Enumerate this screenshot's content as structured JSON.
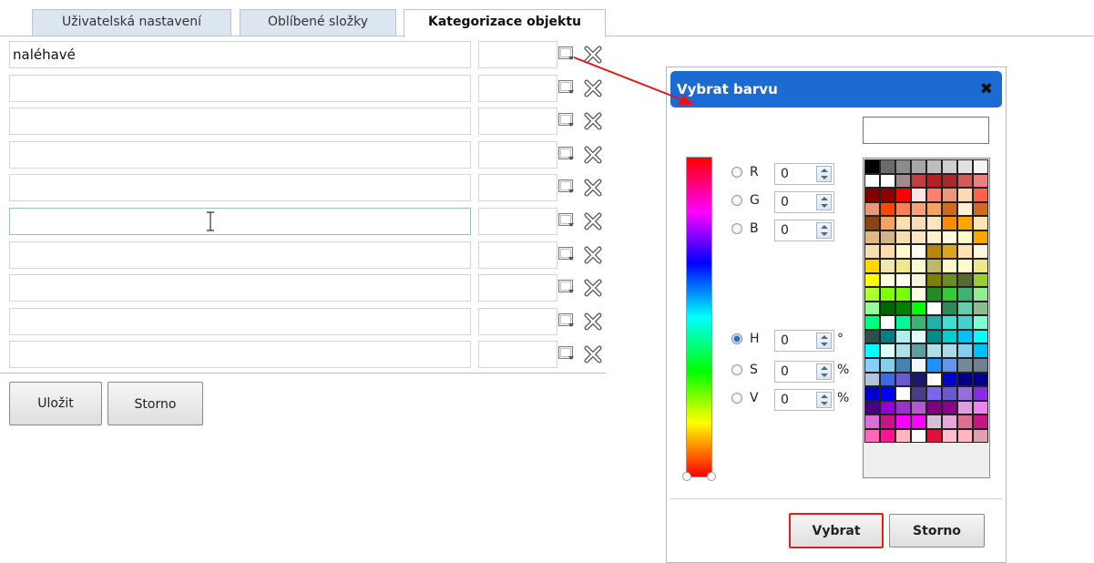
{
  "tabs": [
    {
      "label": "Uživatelská nastavení"
    },
    {
      "label": "Oblíbené složky"
    },
    {
      "label": "Kategorizace objektu",
      "active": true
    }
  ],
  "categories": [
    {
      "name": "naléhavé",
      "color": ""
    },
    {
      "name": "",
      "color": ""
    },
    {
      "name": "",
      "color": ""
    },
    {
      "name": "",
      "color": ""
    },
    {
      "name": "",
      "color": ""
    },
    {
      "name": "",
      "color": ""
    },
    {
      "name": "",
      "color": ""
    },
    {
      "name": "",
      "color": ""
    },
    {
      "name": "",
      "color": ""
    },
    {
      "name": "",
      "color": ""
    }
  ],
  "form_buttons": {
    "save": "Uložit",
    "cancel": "Storno"
  },
  "color_dialog": {
    "title": "Vybrat barvu",
    "close": "✖",
    "hex_value": "",
    "rgb": {
      "r_label": "R",
      "g_label": "G",
      "b_label": "B",
      "r": "0",
      "g": "0",
      "b": "0"
    },
    "hsv": {
      "h_label": "H",
      "s_label": "S",
      "v_label": "V",
      "h": "0",
      "s": "0",
      "v": "0",
      "h_unit": "°",
      "s_unit": "%",
      "v_unit": "%",
      "selected": "H"
    },
    "select_button": "Vybrat",
    "cancel_button": "Storno",
    "palette": [
      "#000000",
      "#6b6b6b",
      "#8c8c8c",
      "#a7a7a7",
      "#bebebe",
      "#cfcfcf",
      "#e1e1e1",
      "#f5f5f5",
      "#ffffff",
      "#ffffff",
      "#a08a8a",
      "#c43c3c",
      "#b22222",
      "#a52a2a",
      "#cd5c5c",
      "#f08080",
      "#800000",
      "#8b0000",
      "#ff0000",
      "#ffe4e1",
      "#fa8072",
      "#e9967a",
      "#ffdab9",
      "#ff6347",
      "#e9967a",
      "#ff4500",
      "#ff7f50",
      "#ffa07a",
      "#f4a460",
      "#d2691e",
      "#ffefd5",
      "#d2691e",
      "#8b4513",
      "#f4a460",
      "#ffdead",
      "#ffdab9",
      "#ffe4c4",
      "#ff8c00",
      "#ffa500",
      "#ffe4b5",
      "#deb887",
      "#d2b48c",
      "#f5deb3",
      "#ffe4c4",
      "#fff0d0",
      "#fff8dc",
      "#fffacd",
      "#ffa500",
      "#f5deb3",
      "#ffdead",
      "#fffacd",
      "#fffff0",
      "#b8860b",
      "#daa520",
      "#ffe4b5",
      "#fff8dc",
      "#ffd700",
      "#eee8aa",
      "#f0e68c",
      "#fafad2",
      "#bdb76b",
      "#fff8c8",
      "#fffacd",
      "#f0e68c",
      "#ffff00",
      "#ffffe0",
      "#fffff0",
      "#f5f5dc",
      "#808000",
      "#6b8e23",
      "#556b2f",
      "#9acd32",
      "#adff2f",
      "#7fff00",
      "#7cfc00",
      "#ffffe0",
      "#228b22",
      "#32cd32",
      "#3cb371",
      "#90ee90",
      "#98fb98",
      "#006400",
      "#008000",
      "#00ff00",
      "#ffffff",
      "#2e8b57",
      "#66cdaa",
      "#8fbc8f",
      "#00ff7f",
      "#ffffff",
      "#00fa9a",
      "#3cb371",
      "#20b2aa",
      "#40e0d0",
      "#48d1cc",
      "#7fffd4",
      "#2f4f4f",
      "#008080",
      "#afeeee",
      "#e0ffff",
      "#008b8b",
      "#00ced1",
      "#00bfff",
      "#00ffff",
      "#00ffff",
      "#e0ffff",
      "#b0e0e6",
      "#5f9ea0",
      "#b0e0e6",
      "#add8e6",
      "#87ceeb",
      "#00bfff",
      "#87cefa",
      "#87ceeb",
      "#4682b4",
      "#f0f8ff",
      "#1e90ff",
      "#6495ed",
      "#778899",
      "#708090",
      "#b0c4de",
      "#4169e1",
      "#6a5acd",
      "#191970",
      "#ffffff",
      "#0000cd",
      "#000080",
      "#00008b",
      "#0000cd",
      "#0000ff",
      "#ffffff",
      "#483d8b",
      "#7b68ee",
      "#6a5acd",
      "#9370db",
      "#8a2be2",
      "#4b0082",
      "#9400d3",
      "#9932cc",
      "#ba55d3",
      "#800080",
      "#8b008b",
      "#dda0dd",
      "#ee82ee",
      "#da70d6",
      "#c71585",
      "#ff00ff",
      "#ff00ff",
      "#d8bfd8",
      "#e6a8d7",
      "#db7093",
      "#c71585",
      "#ff69b4",
      "#ff1493",
      "#ffb6c1",
      "#ffffff",
      "#dc143c",
      "#ffc0cb",
      "#ffb6c1",
      "#e0a0b0",
      "#eeeeee",
      "#eeeeee",
      "#eeeeee",
      "#eeeeee",
      "#eeeeee",
      "#eeeeee",
      "#eeeeee",
      "#eeeeee"
    ]
  }
}
